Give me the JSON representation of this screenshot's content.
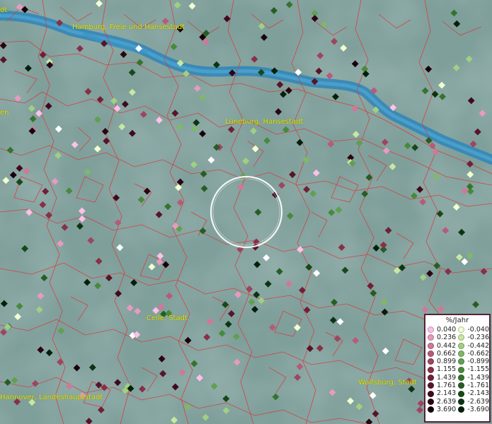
{
  "map": {
    "cities": [
      {
        "id": "city-hamburg",
        "label": "Hamburg, Freie und Hansestadt"
      },
      {
        "id": "city-lueneburg",
        "label": "Lüneburg, Hansestadt"
      },
      {
        "id": "city-celle",
        "label": "Celle, Stadt"
      },
      {
        "id": "city-hannover",
        "label": "Hannover, Landeshauptstadt"
      },
      {
        "id": "city-wolfsburg",
        "label": "Wolfsburg, Stadt"
      }
    ],
    "edge_labels": [
      "dt",
      "en"
    ],
    "colors": {
      "background": "#7f9f9b",
      "river": "#3a8fbf",
      "boundaries": "#d03030",
      "labels": "#e6e600",
      "selection_circle": "#ffffff"
    }
  },
  "legend": {
    "title": "%/Jahr",
    "positive": [
      {
        "value": "0.040",
        "color": "#ffc0e8"
      },
      {
        "value": "0.236",
        "color": "#e89ac0"
      },
      {
        "value": "0.442",
        "color": "#d07898"
      },
      {
        "value": "0.662",
        "color": "#b85a78"
      },
      {
        "value": "0.899",
        "color": "#a04460"
      },
      {
        "value": "1.155",
        "color": "#883048"
      },
      {
        "value": "1.439",
        "color": "#702038"
      },
      {
        "value": "1.761",
        "color": "#581428"
      },
      {
        "value": "2.143",
        "color": "#400a1c"
      },
      {
        "value": "2.639",
        "color": "#2c0412"
      },
      {
        "value": "3.690",
        "color": "#1a0008"
      }
    ],
    "negative": [
      {
        "value": "-0.040",
        "color": "#f2ffd0"
      },
      {
        "value": "-0.236",
        "color": "#c8e8a0"
      },
      {
        "value": "-0.442",
        "color": "#a0d080"
      },
      {
        "value": "-0.662",
        "color": "#80b868"
      },
      {
        "value": "-0.899",
        "color": "#60a050"
      },
      {
        "value": "-1.155",
        "color": "#488a3c"
      },
      {
        "value": "-1.439",
        "color": "#36742e"
      },
      {
        "value": "-1.761",
        "color": "#265e22"
      },
      {
        "value": "-2.143",
        "color": "#184818"
      },
      {
        "value": "-2.639",
        "color": "#0c3410"
      },
      {
        "value": "-3.690",
        "color": "#042008"
      }
    ]
  }
}
